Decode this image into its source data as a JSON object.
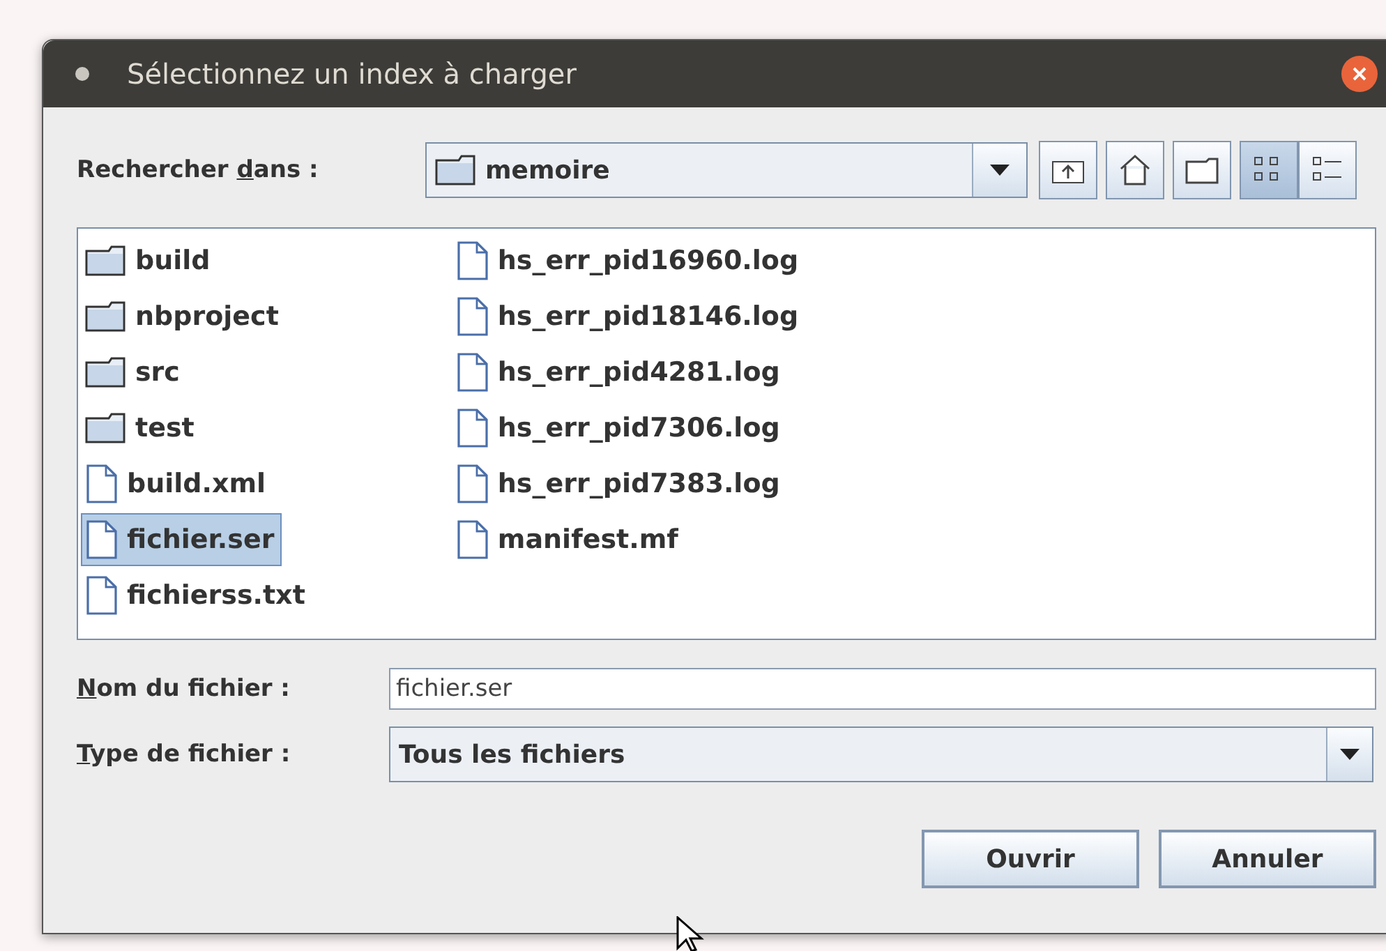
{
  "window": {
    "title": "Sélectionnez un index à charger"
  },
  "look_in": {
    "label_before": "Rechercher ",
    "mnemonic": "d",
    "label_after": "ans :",
    "value": "memoire"
  },
  "toolbar": [
    {
      "kind": "up",
      "selected": false
    },
    {
      "kind": "home",
      "selected": false
    },
    {
      "kind": "new-folder",
      "selected": false
    },
    {
      "kind": "list-view",
      "selected": true
    },
    {
      "kind": "details-view",
      "selected": false
    }
  ],
  "files": [
    {
      "name": "build",
      "kind": "folder",
      "selected": false
    },
    {
      "name": "nbproject",
      "kind": "folder",
      "selected": false
    },
    {
      "name": "src",
      "kind": "folder",
      "selected": false
    },
    {
      "name": "test",
      "kind": "folder",
      "selected": false
    },
    {
      "name": "build.xml",
      "kind": "file",
      "selected": false
    },
    {
      "name": "fichier.ser",
      "kind": "file",
      "selected": true
    },
    {
      "name": "fichierss.txt",
      "kind": "file",
      "selected": false
    },
    {
      "name": "hs_err_pid16960.log",
      "kind": "file",
      "selected": false
    },
    {
      "name": "hs_err_pid18146.log",
      "kind": "file",
      "selected": false
    },
    {
      "name": "hs_err_pid4281.log",
      "kind": "file",
      "selected": false
    },
    {
      "name": "hs_err_pid7306.log",
      "kind": "file",
      "selected": false
    },
    {
      "name": "hs_err_pid7383.log",
      "kind": "file",
      "selected": false
    },
    {
      "name": "manifest.mf",
      "kind": "file",
      "selected": false
    }
  ],
  "file_name": {
    "mnemonic": "N",
    "label_after": "om du fichier :",
    "value": "fichier.ser"
  },
  "file_type": {
    "mnemonic": "T",
    "label_after": "ype de fichier :",
    "value": "Tous les fichiers"
  },
  "buttons": [
    "Ouvrir",
    "Annuler"
  ]
}
